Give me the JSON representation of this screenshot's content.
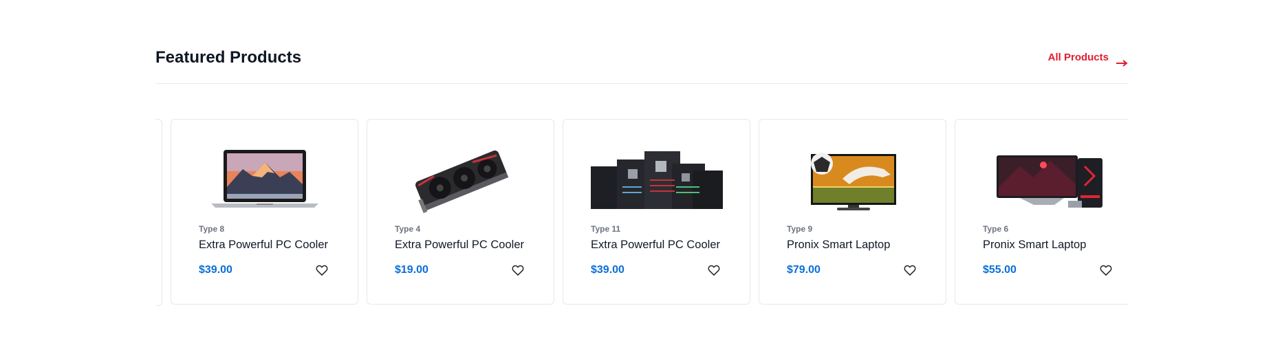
{
  "section": {
    "title": "Featured Products",
    "all_products_label": "All Products",
    "accent_color": "#e11d2e",
    "price_color": "#0a6fd8"
  },
  "products": [
    {
      "type": "Type 8",
      "name": "Extra Powerful PC Cooler",
      "price": "$39.00",
      "image": "laptop-macbook"
    },
    {
      "type": "Type 4",
      "name": "Extra Powerful PC Cooler",
      "price": "$19.00",
      "image": "graphics-card"
    },
    {
      "type": "Type 11",
      "name": "Extra Powerful PC Cooler",
      "price": "$39.00",
      "image": "motherboards"
    },
    {
      "type": "Type 9",
      "name": "Pronix Smart Laptop",
      "price": "$79.00",
      "image": "television"
    },
    {
      "type": "Type 6",
      "name": "Pronix Smart Laptop",
      "price": "$55.00",
      "image": "gaming-pc-monitor"
    }
  ]
}
